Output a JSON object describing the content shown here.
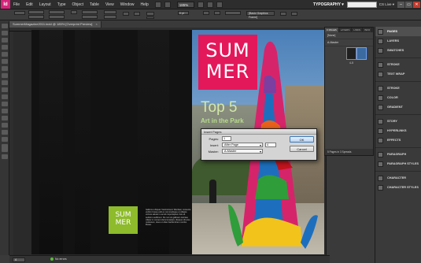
{
  "app": {
    "logo": "Id",
    "menus": [
      "File",
      "Edit",
      "Layout",
      "Type",
      "Object",
      "Table",
      "View",
      "Window",
      "Help"
    ],
    "zoom": "185%",
    "workspace": "TYPOGRAPHY ▾",
    "cs_live": "CS Live ▾",
    "window_buttons": [
      "–",
      "▭",
      "✕"
    ]
  },
  "control_panel": {
    "stroke_weight": "0 pt",
    "frame_style": "[Basic Graphics Frame]"
  },
  "document": {
    "tab_title": "SummerMagazine2011.indd @ 185% [Overprint Preview]",
    "tab_close": "×"
  },
  "spread": {
    "left_logo": [
      "SUM",
      "MER"
    ],
    "left_body": "Isalluma ubiquan Vestiminsem Werdaat, consecte verbim bossa velit ex commodoque et ulliapre velmos ailutat in eumd corporisiptum fuis sit seddom sedfimuri. Sit cum sit gallinam istonias ciliatur in coment cleinconsetare, ilissaum ilit ame mollesium, dues ut ullam facilisi lorem numbo libeae.",
    "right_logo": [
      "SUM",
      "MER"
    ],
    "headline": "Top 5",
    "subhead": "Art in the Park"
  },
  "dialog": {
    "title": "Insert Pages",
    "pages_label": "Pages:",
    "pages_value": "1",
    "insert_label": "Insert:",
    "insert_value": "After Page",
    "insert_page_value": "4",
    "master_label": "Master:",
    "master_value": "A-Master",
    "ok_label": "OK",
    "cancel_label": "Cancel"
  },
  "pages_panel": {
    "tabs": [
      "≡ PAGES",
      "LAYERS",
      "LINKS",
      "INFO"
    ],
    "none_item": "[None]",
    "master_item": "A-Master",
    "spread_label": "4-5",
    "footer": "5 Pages in 3 Spreads"
  },
  "dock": {
    "items": [
      {
        "label": "PAGES",
        "icon": "pages-icon",
        "active": true
      },
      {
        "label": "LAYERS",
        "icon": "layers-icon"
      },
      {
        "label": "SWATCHES",
        "icon": "swatches-icon"
      },
      {
        "label": "STROKE",
        "icon": "stroke-icon",
        "sep_before": true
      },
      {
        "label": "TEXT WRAP",
        "icon": "text-wrap-icon"
      },
      {
        "label": "STROKE",
        "icon": "stroke-icon",
        "sep_before": true
      },
      {
        "label": "COLOR",
        "icon": "color-icon"
      },
      {
        "label": "GRADIENT",
        "icon": "gradient-icon"
      },
      {
        "label": "STORY",
        "icon": "story-icon",
        "sep_before": true
      },
      {
        "label": "HYPERLINKS",
        "icon": "hyperlinks-icon"
      },
      {
        "label": "EFFECTS",
        "icon": "effects-icon"
      },
      {
        "label": "PARAGRAPH",
        "icon": "paragraph-icon",
        "sep_before": true
      },
      {
        "label": "PARAGRAPH STYLES",
        "icon": "paragraph-styles-icon"
      },
      {
        "label": "CHARACTER",
        "icon": "character-icon",
        "sep_before": true
      },
      {
        "label": "CHARACTER STYLES",
        "icon": "character-styles-icon"
      }
    ]
  },
  "status": {
    "page_number": "4",
    "error_text": "No errors"
  },
  "colors": {
    "summer_pink": "#e3185b",
    "summer_green": "#8dbb2b",
    "headline_green": "#d3e8a8"
  }
}
